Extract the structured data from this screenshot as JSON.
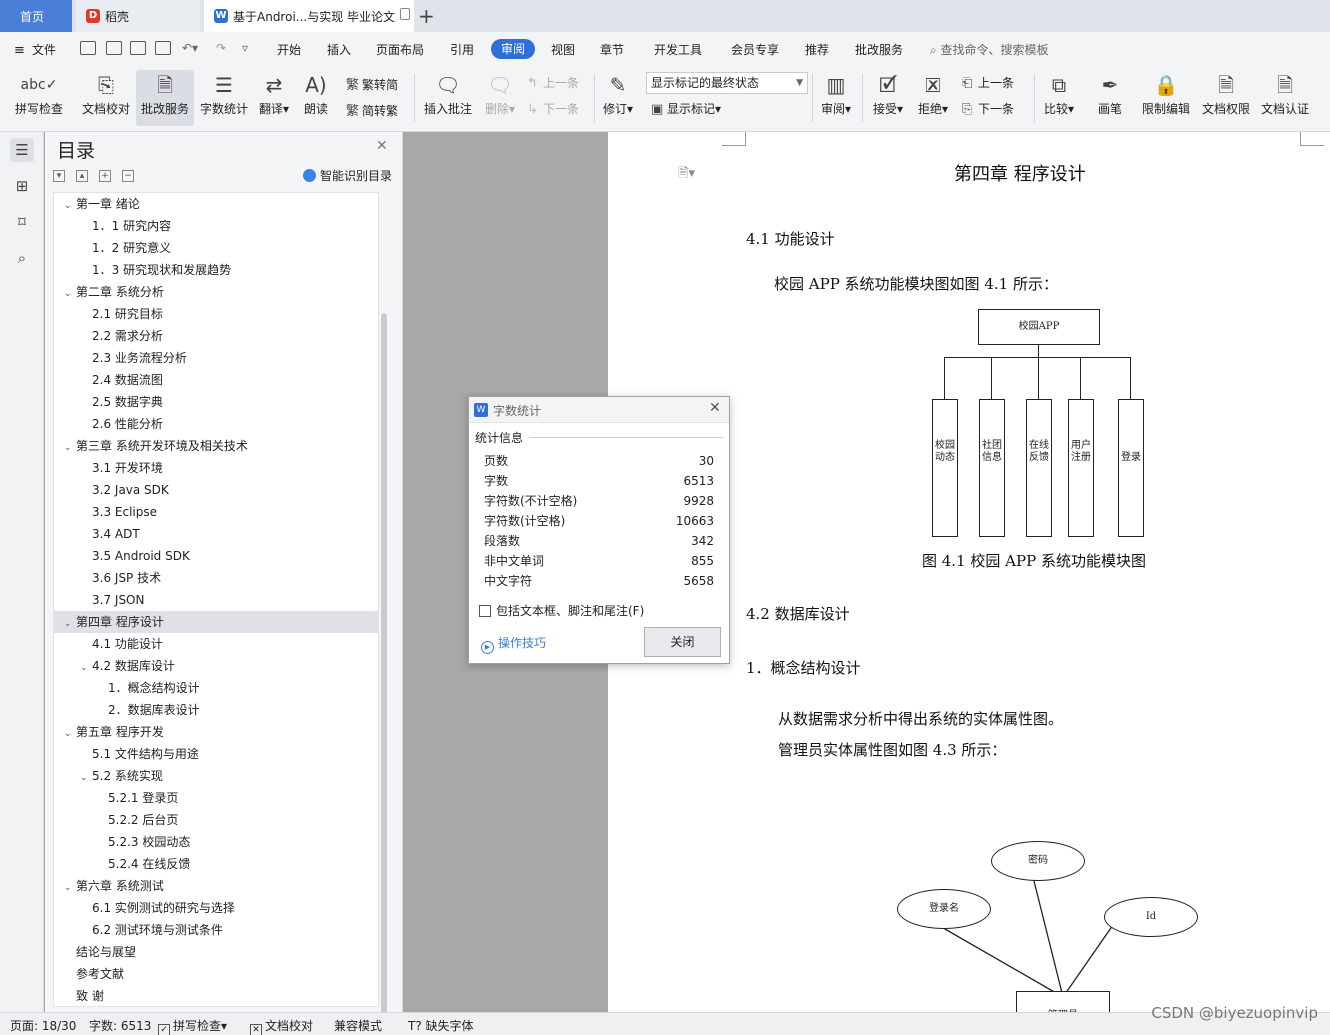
{
  "tabs": {
    "home": "首页",
    "daoke": "稻壳",
    "document": "基于Androi...与实现 毕业论文",
    "add": "+"
  },
  "menu": {
    "file": "文件",
    "items": [
      "开始",
      "插入",
      "页面布局",
      "引用",
      "审阅",
      "视图",
      "章节",
      "开发工具",
      "会员专享",
      "推荐",
      "批改服务"
    ],
    "active": "审阅",
    "search": "查找命令、搜索模板"
  },
  "ribbon": {
    "spellcheck": "拼写检查",
    "proofread": "文档校对",
    "review_service": "批改服务",
    "word_count": "字数统计",
    "translate": "翻译",
    "read_aloud": "朗读",
    "trad_to_simp": "繁转简",
    "simp_to_trad": "简转繁",
    "insert_comment": "插入批注",
    "delete": "删除",
    "prev": "上一条",
    "next": "下一条",
    "revise": "修订",
    "show_state": "显示标记的最终状态",
    "show_markup": "显示标记",
    "review": "审阅",
    "accept": "接受",
    "reject": "拒绝",
    "prev2": "上一条",
    "next2": "下一条",
    "compare": "比较",
    "pen": "画笔",
    "restrict_edit": "限制编辑",
    "doc_permission": "文档权限",
    "doc_auth": "文档认证"
  },
  "toc": {
    "title": "目录",
    "smart": "智能识别目录",
    "items": [
      {
        "text": "第一章  绪论",
        "level": 0,
        "arrow": "v"
      },
      {
        "text": "1．1  研究内容",
        "level": 1
      },
      {
        "text": "1．2  研究意义",
        "level": 1
      },
      {
        "text": "1．3 研究现状和发展趋势",
        "level": 1
      },
      {
        "text": "第二章    系统分析",
        "level": 0,
        "arrow": "v"
      },
      {
        "text": "2.1  研究目标",
        "level": 1
      },
      {
        "text": "2.2  需求分析",
        "level": 1
      },
      {
        "text": "2.3 业务流程分析",
        "level": 1
      },
      {
        "text": "2.4 数据流图",
        "level": 1
      },
      {
        "text": "2.5 数据字典",
        "level": 1
      },
      {
        "text": "2.6 性能分析",
        "level": 1
      },
      {
        "text": "第三章  系统开发环境及相关技术",
        "level": 0,
        "arrow": "v"
      },
      {
        "text": "3.1 开发环境",
        "level": 1
      },
      {
        "text": "3.2 Java SDK",
        "level": 1
      },
      {
        "text": "3.3 Eclipse",
        "level": 1
      },
      {
        "text": "3.4 ADT",
        "level": 1
      },
      {
        "text": "3.5 Android SDK",
        "level": 1
      },
      {
        "text": "3.6 JSP 技术",
        "level": 1
      },
      {
        "text": "3.7 JSON",
        "level": 1
      },
      {
        "text": "第四章  程序设计",
        "level": 0,
        "arrow": "v",
        "selected": true
      },
      {
        "text": "4.1    功能设计",
        "level": 1
      },
      {
        "text": "4.2    数据库设计",
        "level": 1,
        "arrow": "v"
      },
      {
        "text": "1．概念结构设计",
        "level": 2
      },
      {
        "text": "2．数据库表设计",
        "level": 2
      },
      {
        "text": "第五章  程序开发",
        "level": 0,
        "arrow": "v"
      },
      {
        "text": "5.1    文件结构与用途",
        "level": 1
      },
      {
        "text": "5.2  系统实现",
        "level": 1,
        "arrow": "v"
      },
      {
        "text": "5.2.1 登录页",
        "level": 2
      },
      {
        "text": "5.2.2 后台页",
        "level": 2
      },
      {
        "text": "5.2.3 校园动态",
        "level": 2
      },
      {
        "text": "5.2.4 在线反馈",
        "level": 2
      },
      {
        "text": "第六章    系统测试",
        "level": 0,
        "arrow": "v"
      },
      {
        "text": "6.1 实例测试的研究与选择",
        "level": 1
      },
      {
        "text": "6.2 测试环境与测试条件",
        "level": 1
      },
      {
        "text": "结论与展望",
        "level": 0
      },
      {
        "text": "参考文献",
        "level": 0
      },
      {
        "text": "致    谢",
        "level": 0
      }
    ]
  },
  "document": {
    "chapter_title": "第四章  程序设计",
    "s41": "4.1    功能设计",
    "p1": "校园 APP 系统功能模块图如图 4.1 所示：",
    "diagram_root": "校园APP",
    "diagram_modules": [
      "校园动态",
      "社团信息",
      "在线反馈",
      "用户注册",
      "登录"
    ],
    "fig_caption": "图 4.1  校园 APP 系统功能模块图",
    "s42": "4.2    数据库设计",
    "s1": "1．概念结构设计",
    "p2": "从数据需求分析中得出系统的实体属性图。",
    "p3": "管理员实体属性图如图 4.3 所示：",
    "er_password": "密码",
    "er_login": "登录名",
    "er_id": "Id",
    "er_admin": "管理员"
  },
  "dialog": {
    "title": "字数统计",
    "section": "统计信息",
    "stats": [
      {
        "label": "页数",
        "value": "30"
      },
      {
        "label": "字数",
        "value": "6513"
      },
      {
        "label": "字符数(不计空格)",
        "value": "9928"
      },
      {
        "label": "字符数(计空格)",
        "value": "10663"
      },
      {
        "label": "段落数",
        "value": "342"
      },
      {
        "label": "非中文单词",
        "value": "855"
      },
      {
        "label": "中文字符",
        "value": "5658"
      }
    ],
    "include_label": "包括文本框、脚注和尾注(F)",
    "tips": "操作技巧",
    "close": "关闭"
  },
  "status": {
    "page": "页面: 18/30",
    "words": "字数: 6513",
    "spell": "拼写检查",
    "proof": "文档校对",
    "compat": "兼容模式",
    "missing_font": "缺失字体"
  },
  "watermark": "CSDN @biyezuopinvip",
  "colors": {
    "accent": "#2f6fd8",
    "home_tab": "#4a7fd8"
  }
}
